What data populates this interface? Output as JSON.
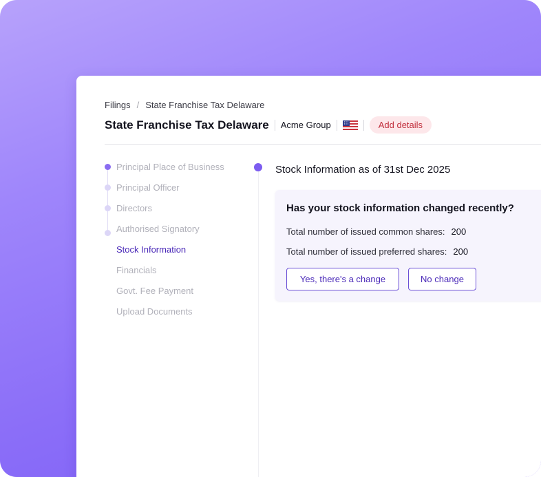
{
  "breadcrumb": {
    "root": "Filings",
    "separator": "/",
    "current": "State Franchise Tax Delaware"
  },
  "header": {
    "title": "State Franchise Tax Delaware",
    "company": "Acme Group",
    "flag_icon": "us-flag-icon",
    "add_details_label": "Add details"
  },
  "sidebar": {
    "items": [
      {
        "label": "Principal Place of Business",
        "state": "done"
      },
      {
        "label": "Principal Officer",
        "state": "pending"
      },
      {
        "label": "Directors",
        "state": "pending"
      },
      {
        "label": "Authorised Signatory",
        "state": "pending"
      },
      {
        "label": "Stock Information",
        "state": "active"
      },
      {
        "label": "Financials",
        "state": "upcoming"
      },
      {
        "label": "Govt. Fee Payment",
        "state": "upcoming"
      },
      {
        "label": "Upload Documents",
        "state": "upcoming"
      }
    ]
  },
  "main": {
    "step_title": "Stock Information as of 31st Dec 2025",
    "card": {
      "question": "Has your stock information changed recently?",
      "rows": [
        {
          "label": "Total number of issued common shares:",
          "value": "200"
        },
        {
          "label": "Total number of issued preferred shares:",
          "value": "200"
        }
      ],
      "yes_button": "Yes, there's a change",
      "no_button": "No change"
    }
  },
  "colors": {
    "accent": "#7c5cf0",
    "active_text": "#4a29b8",
    "badge_bg": "#fde7ea",
    "badge_text": "#c2303e",
    "background_gradient_start": "#b7a2fb",
    "background_gradient_end": "#7a5cf5"
  }
}
